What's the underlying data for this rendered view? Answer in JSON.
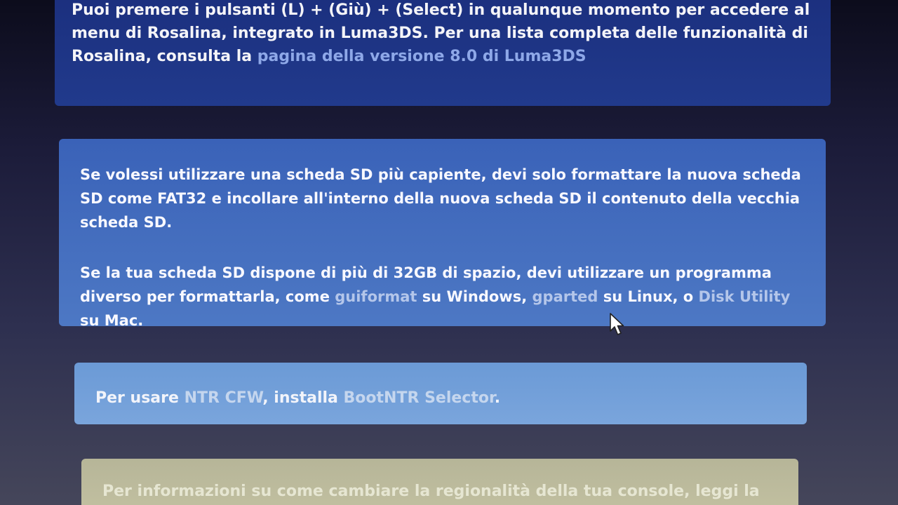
{
  "rosalina_notice": {
    "text_before": "Puoi premere i pulsanti (L) + (Giù) + (Select) in qualunque momento per accedere al menu di Rosalina, integrato in Luma3DS. Per una lista completa delle funzionalità di Rosalina, consulta la ",
    "link_label": "pagina della versione 8.0 di Luma3DS"
  },
  "sd_notice": {
    "paragraph1": "Se volessi utilizzare una scheda SD più capiente, devi solo formattare la nuova scheda SD come FAT32 e incollare all'interno della nuova scheda SD il contenuto della vecchia scheda SD.",
    "p2_before": "Se la tua scheda SD dispone di più di 32GB di spazio, devi utilizzare un programma diverso per formattarla, come ",
    "link_guiformat": "guiformat",
    "p2_mid1": " su Windows, ",
    "link_gparted": "gparted",
    "p2_mid2": " su Linux, o ",
    "link_disk_utility": "Disk Utility",
    "p2_after": " su Mac."
  },
  "ntr_notice": {
    "text_before": "Per usare ",
    "link_ntr": "NTR CFW",
    "text_mid": ", installa ",
    "link_bootntr": "BootNTR Selector",
    "text_after": "."
  },
  "region_notice": {
    "text": "Per informazioni su come cambiare la regionalità della tua console, leggi la"
  }
}
